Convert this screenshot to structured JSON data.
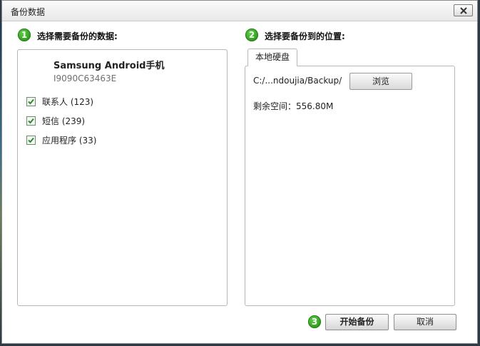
{
  "window": {
    "title": "备份数据"
  },
  "step1": {
    "number": "1",
    "label": "选择需要备份的数据:"
  },
  "step2": {
    "number": "2",
    "label": "选择要备份到的位置:"
  },
  "step3": {
    "number": "3"
  },
  "device": {
    "name": "Samsung Android手机",
    "serial": "I9090C63463E"
  },
  "data_items": [
    {
      "label": "联系人 (123)",
      "checked": true
    },
    {
      "label": "短信 (239)",
      "checked": true
    },
    {
      "label": "应用程序 (33)",
      "checked": true
    }
  ],
  "location": {
    "tab_label": "本地硬盘",
    "path": "C:/...ndoujia/Backup/",
    "browse_label": "浏览",
    "free_space": "剩余空间：556.80M"
  },
  "actions": {
    "start_label": "开始备份",
    "cancel_label": "取消"
  },
  "colors": {
    "step_badge": "#2e9a1c",
    "border": "#b7b7b7",
    "checkmark": "#2e8b2e"
  },
  "icons": {
    "close": "close-icon",
    "check": "checkmark-icon"
  }
}
